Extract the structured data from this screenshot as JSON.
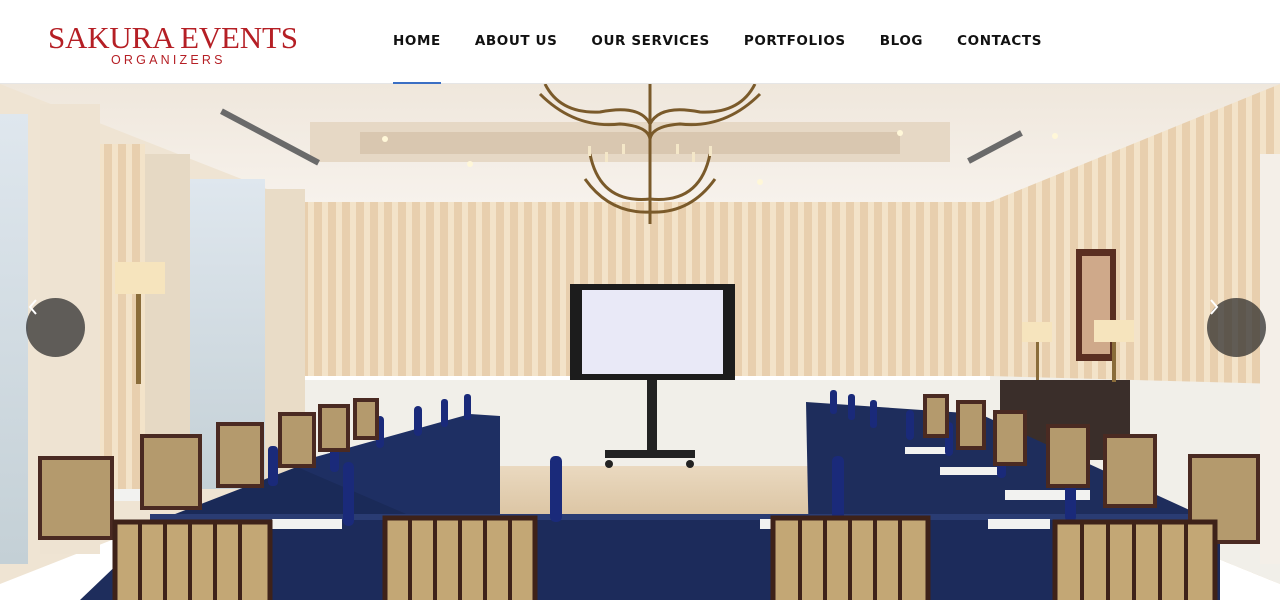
{
  "brand": {
    "name": "SAKURA EVENTS",
    "tagline": "ORGANIZERS",
    "color": "#b51f25"
  },
  "nav": {
    "items": [
      {
        "label": "HOME",
        "active": true
      },
      {
        "label": "ABOUT US",
        "active": false
      },
      {
        "label": "OUR SERVICES",
        "active": false
      },
      {
        "label": "PORTFOLIOS",
        "active": false
      },
      {
        "label": "BLOG",
        "active": false
      },
      {
        "label": "CONTACTS",
        "active": false
      }
    ],
    "active_color": "#3b6fc4"
  },
  "hero": {
    "image": "conference-room-photo",
    "prev_icon": "chevron-left-icon",
    "next_icon": "chevron-right-icon"
  }
}
